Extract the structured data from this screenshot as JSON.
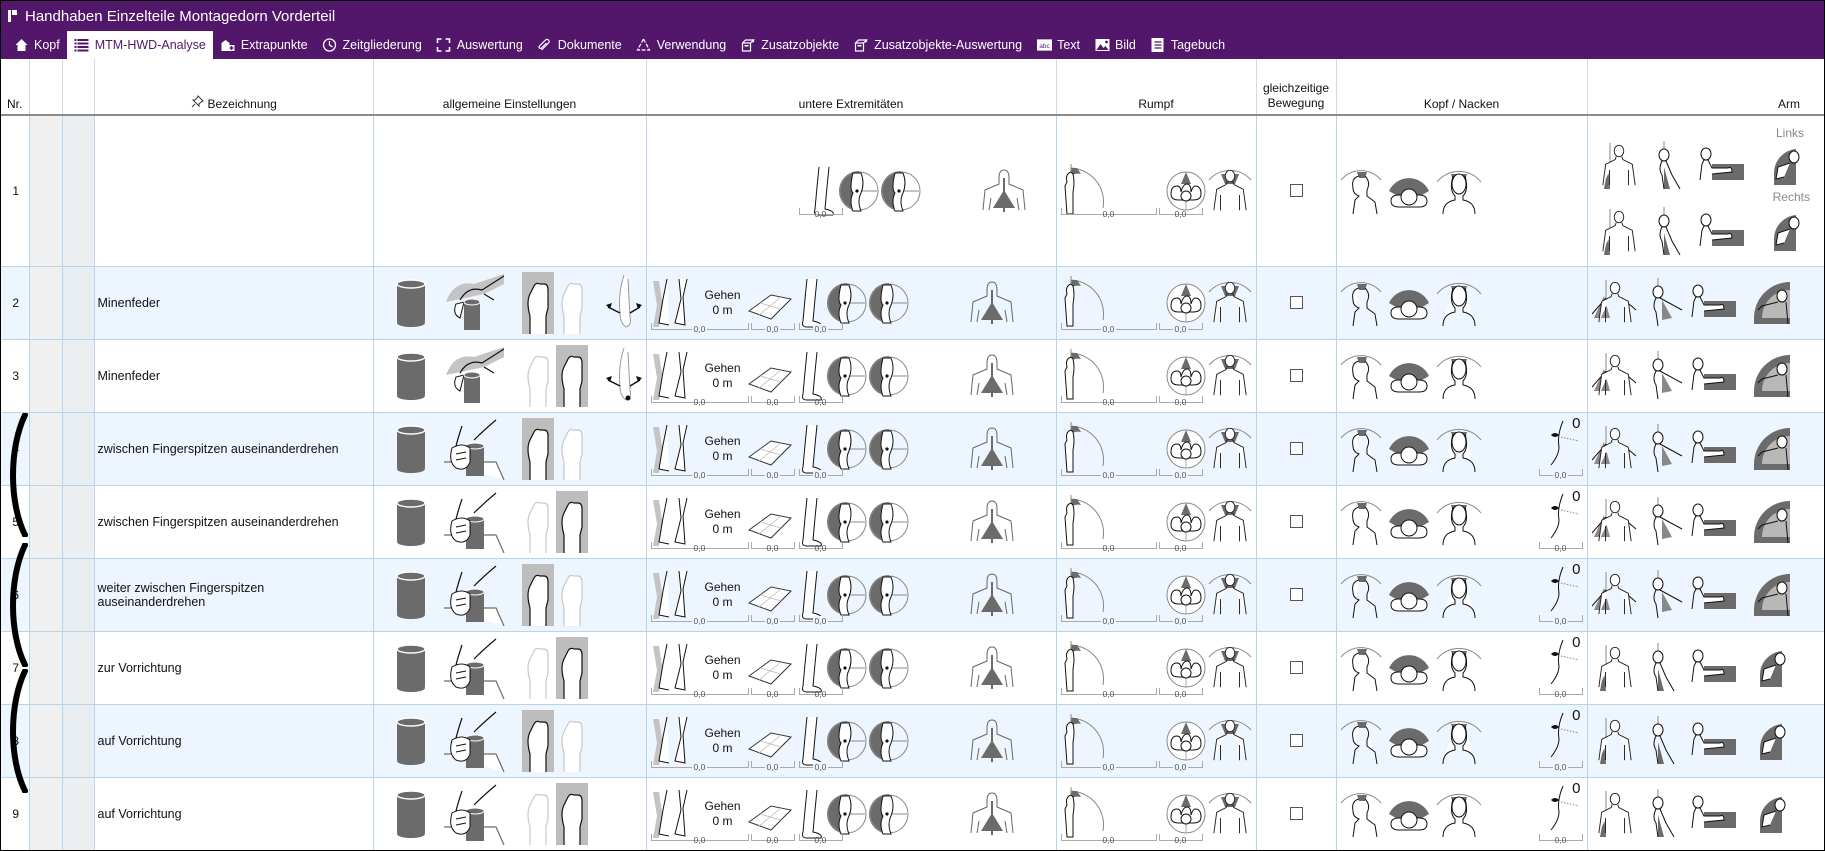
{
  "window": {
    "title": "Handhaben Einzelteile Montagedorn Vorderteil"
  },
  "tabs": [
    {
      "label": "Kopf",
      "icon": "home-icon",
      "active": false
    },
    {
      "label": "MTM-HWD-Analyse",
      "icon": "list-icon",
      "active": true
    },
    {
      "label": "Extrapunkte",
      "icon": "extrapoints-icon",
      "active": false
    },
    {
      "label": "Zeitgliederung",
      "icon": "clock-icon",
      "active": false
    },
    {
      "label": "Auswertung",
      "icon": "evaluation-icon",
      "active": false
    },
    {
      "label": "Dokumente",
      "icon": "paperclip-icon",
      "active": false
    },
    {
      "label": "Verwendung",
      "icon": "recycle-icon",
      "active": false
    },
    {
      "label": "Zusatzobjekte",
      "icon": "box-icon",
      "active": false
    },
    {
      "label": "Zusatzobjekte-Auswertung",
      "icon": "box-icon",
      "active": false
    },
    {
      "label": "Text",
      "icon": "abc-text-icon",
      "active": false
    },
    {
      "label": "Bild",
      "icon": "image-icon",
      "active": false
    },
    {
      "label": "Tagebuch",
      "icon": "journal-icon",
      "active": false
    }
  ],
  "table": {
    "headers": {
      "nr": "Nr.",
      "bezeichnung": "Bezeichnung",
      "allgemein": "allgemeine Einstellungen",
      "untere": "untere Extremitäten",
      "rumpf": "Rumpf",
      "gleichzeitig_1": "gleichzeitige",
      "gleichzeitig_2": "Bewegung",
      "kopf": "Kopf / Nacken",
      "arm": "Arm"
    },
    "arm_labels": {
      "left": "Links",
      "right": "Rechts"
    },
    "gehen_label": "Gehen",
    "gehen_distance": "0 m",
    "rows": [
      {
        "nr": "1",
        "bezeichnung": "",
        "leg_val": "0,0",
        "rumpf_val1": "0,0",
        "rumpf_val2": "0,0"
      },
      {
        "nr": "2",
        "bezeichnung": "Minenfeder",
        "walk_val": "0,0",
        "floor_val": "0,0",
        "leg_val": "0,0",
        "rumpf_val1": "0,0",
        "rumpf_val2": "0,0",
        "grip": "from-top",
        "active_hand": "left",
        "wrist": true
      },
      {
        "nr": "3",
        "bezeichnung": "Minenfeder",
        "walk_val": "0,0",
        "floor_val": "0,0",
        "leg_val": "0,0",
        "rumpf_val1": "0,0",
        "rumpf_val2": "0,0",
        "grip": "from-top",
        "active_hand": "right",
        "wrist": true
      },
      {
        "nr": "4",
        "bezeichnung": "zwischen Fingerspitzen auseinanderdrehen",
        "walk_val": "0,0",
        "floor_val": "0,0",
        "leg_val": "0,0",
        "rumpf_val1": "0,0",
        "rumpf_val2": "0,0",
        "grip": "side",
        "active_hand": "left",
        "eye_val": "0",
        "eye_sub": "0,0"
      },
      {
        "nr": "5",
        "bezeichnung": "zwischen Fingerspitzen auseinanderdrehen",
        "walk_val": "0,0",
        "floor_val": "0,0",
        "leg_val": "0,0",
        "rumpf_val1": "0,0",
        "rumpf_val2": "0,0",
        "grip": "side",
        "active_hand": "right",
        "eye_val": "0",
        "eye_sub": "0,0"
      },
      {
        "nr": "6",
        "bezeichnung": "weiter zwischen Fingerspitzen auseinanderdrehen",
        "walk_val": "0,0",
        "floor_val": "0,0",
        "leg_val": "0,0",
        "rumpf_val1": "0,0",
        "rumpf_val2": "0,0",
        "grip": "side",
        "active_hand": "left",
        "eye_val": "0",
        "eye_sub": "0,0"
      },
      {
        "nr": "7",
        "bezeichnung": "zur Vorrichtung",
        "walk_val": "0,0",
        "floor_val": "0,0",
        "leg_val": "0,0",
        "rumpf_val1": "0,0",
        "rumpf_val2": "0,0",
        "grip": "side",
        "active_hand": "right",
        "eye_val": "0",
        "eye_sub": "0,0"
      },
      {
        "nr": "8",
        "bezeichnung": "auf Vorrichtung",
        "walk_val": "0,0",
        "floor_val": "0,0",
        "leg_val": "0,0",
        "rumpf_val1": "0,0",
        "rumpf_val2": "0,0",
        "grip": "side",
        "active_hand": "left",
        "eye_val": "0",
        "eye_sub": "0,0"
      },
      {
        "nr": "9",
        "bezeichnung": "auf Vorrichtung",
        "walk_val": "0,0",
        "floor_val": "0,0",
        "leg_val": "0,0",
        "rumpf_val1": "0,0",
        "rumpf_val2": "0,0",
        "grip": "side",
        "active_hand": "right",
        "eye_val": "0",
        "eye_sub": "0,0"
      }
    ]
  },
  "colors": {
    "brand": "#52176b",
    "row_alt": "#edf6fe",
    "icon_fill": "#6b6b6b"
  }
}
